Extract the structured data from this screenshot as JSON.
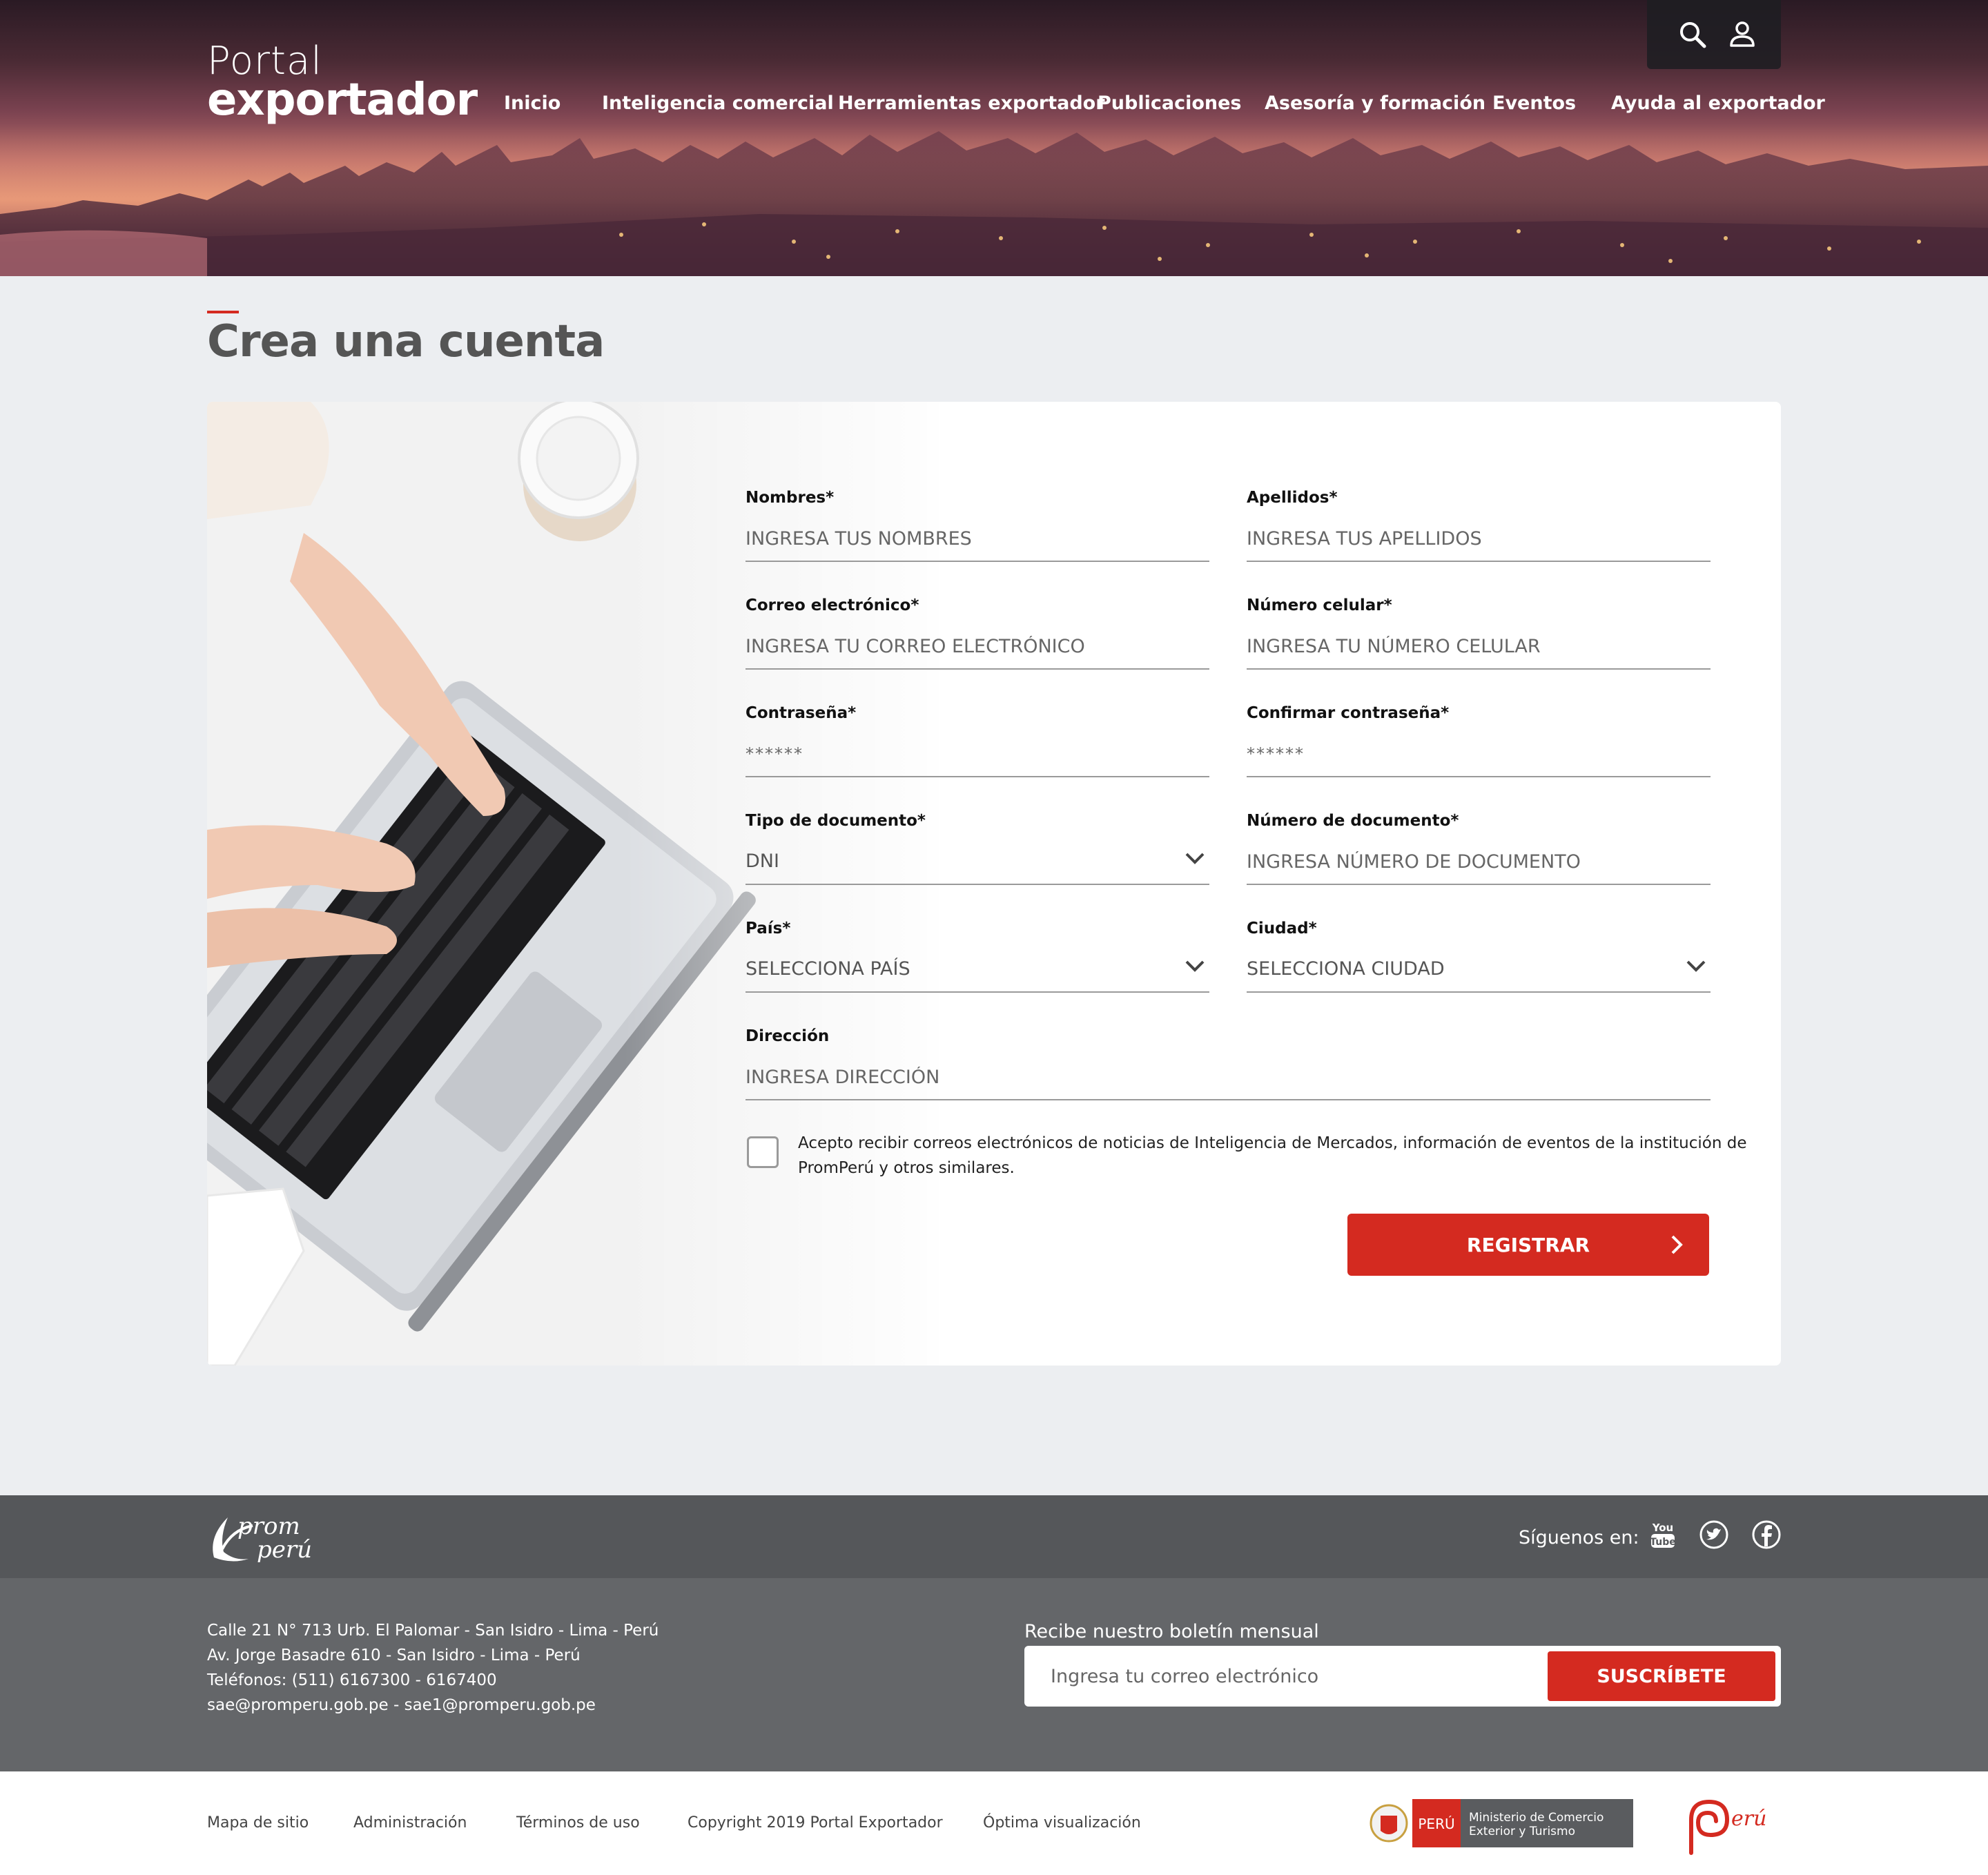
{
  "header": {
    "logo_line1": "Portal",
    "logo_line2": "exportador",
    "search_icon": "search-icon",
    "user_icon": "user-icon",
    "nav": [
      {
        "label": "Inicio"
      },
      {
        "label": "Inteligencia comercial"
      },
      {
        "label": "Herramientas exportador"
      },
      {
        "label": "Publicaciones"
      },
      {
        "label": "Asesoría y formación"
      },
      {
        "label": "Eventos"
      },
      {
        "label": "Ayuda al exportador"
      }
    ]
  },
  "page": {
    "title": "Crea una cuenta"
  },
  "form": {
    "nombres": {
      "label": "Nombres*",
      "placeholder": "INGRESA TUS NOMBRES"
    },
    "apellidos": {
      "label": "Apellidos*",
      "placeholder": "INGRESA TUS APELLIDOS"
    },
    "correo": {
      "label": "Correo electrónico*",
      "placeholder": "INGRESA TU CORREO ELECTRÓNICO"
    },
    "celular": {
      "label": "Número celular*",
      "placeholder": "INGRESA TU NÚMERO CELULAR"
    },
    "password": {
      "label": "Contraseña*",
      "placeholder": "******"
    },
    "confirm_password": {
      "label": "Confirmar contraseña*",
      "placeholder": "******"
    },
    "tipo_documento": {
      "label": "Tipo de documento*",
      "value": "DNI"
    },
    "numero_documento": {
      "label": "Número de documento*",
      "placeholder": "INGRESA NÚMERO DE DOCUMENTO"
    },
    "pais": {
      "label": "País*",
      "value": "SELECCIONA PAÍS"
    },
    "ciudad": {
      "label": "Ciudad*",
      "value": "SELECCIONA CIUDAD"
    },
    "direccion": {
      "label": "Dirección",
      "placeholder": "INGRESA DIRECCIÓN"
    },
    "consent_text": "Acepto recibir correos electrónicos de noticias de Inteligencia de Mercados, información de eventos de la institución de PromPerú y otros similares.",
    "consent_checked": false,
    "submit_label": "REGISTRAR"
  },
  "footer": {
    "brand": "prom perú",
    "follow_label": "Síguenos en:",
    "social": [
      "youtube-icon",
      "twitter-icon",
      "facebook-icon"
    ],
    "address_lines": [
      "Calle 21 N° 713 Urb. El Palomar - San Isidro - Lima - Perú",
      "Av. Jorge Basadre 610 - San Isidro - Lima - Perú",
      "Teléfonos: (511) 6167300 - 6167400",
      "sae@promperu.gob.pe - sae1@promperu.gob.pe"
    ],
    "newsletter_title": "Recibe nuestro boletín mensual",
    "newsletter_placeholder": "Ingresa tu correo electrónico",
    "newsletter_button": "SUSCRÍBETE",
    "links": [
      {
        "label": "Mapa de sitio"
      },
      {
        "label": "Administración"
      },
      {
        "label": "Términos de uso"
      },
      {
        "label": "Copyright 2019 Portal Exportador"
      },
      {
        "label": "Óptima visualización"
      }
    ],
    "mincetur_peru": "PERÚ",
    "mincetur_line1": "Ministerio de Comercio",
    "mincetur_line2": "Exterior y Turismo",
    "marca_peru": "Perú"
  },
  "colors": {
    "accent": "#d42a20",
    "footer_dark": "#55575a",
    "footer_mid": "#646669",
    "page_bg": "#eceef1"
  }
}
